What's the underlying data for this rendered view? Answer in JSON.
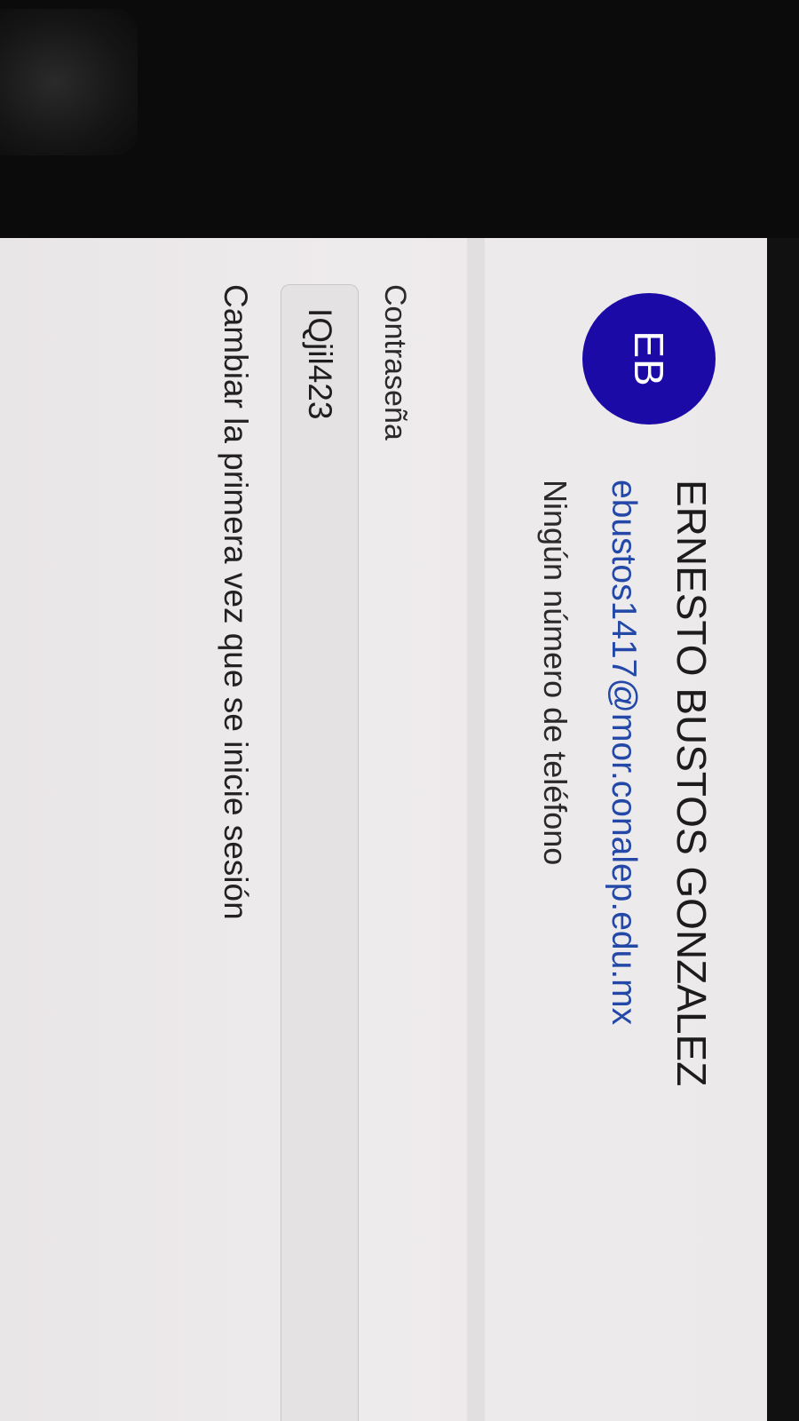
{
  "user": {
    "initials": "EB",
    "name": "ERNESTO BUSTOS GONZALEZ",
    "email": "ebustos1417@mor.conalep.edu.mx",
    "phone": "Ningún número de teléfono"
  },
  "password": {
    "label": "Contraseña",
    "value": "IQjil423",
    "change_note": "Cambiar la primera vez que se inicie sesión"
  },
  "colors": {
    "avatar_bg": "#1b0aa6",
    "email_link": "#2348a8"
  }
}
